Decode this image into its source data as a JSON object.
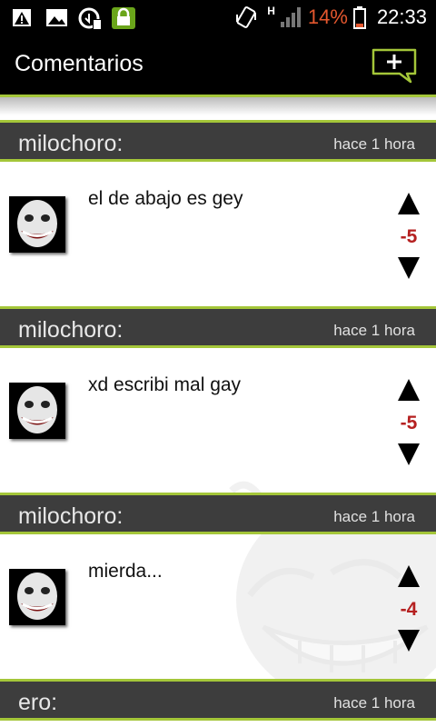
{
  "status_bar": {
    "battery_percent": "14%",
    "time": "22:33",
    "network": "H",
    "icons": [
      "warning-icon",
      "image-icon",
      "sync-icon",
      "lock-icon",
      "vibrate-icon",
      "signal-icon",
      "battery-icon"
    ]
  },
  "action_bar": {
    "title": "Comentarios",
    "add_comment_icon": "add-comment-icon"
  },
  "comments": [
    {
      "author": "milochoro:",
      "time": "hace 1 hora",
      "text": "el de abajo es gey",
      "score": "-5"
    },
    {
      "author": "milochoro:",
      "time": "hace 1 hora",
      "text": "xd escribi mal gay",
      "score": "-5"
    },
    {
      "author": "milochoro:",
      "time": "hace 1 hora",
      "text": "mierda...",
      "score": "-4"
    },
    {
      "author": "ero:",
      "time": "hace 1 hora"
    }
  ],
  "colors": {
    "accent": "#a4c639",
    "header_bg": "#3d3d3d",
    "score": "#b52020",
    "battery_low": "#e4572e"
  }
}
